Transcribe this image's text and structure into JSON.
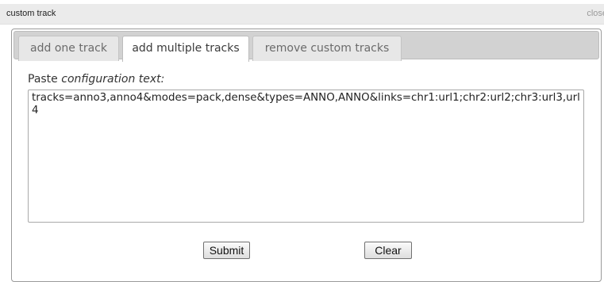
{
  "window": {
    "title": "custom track",
    "close_label": "close"
  },
  "tabs": [
    {
      "label": "add one track",
      "active": false
    },
    {
      "label": "add multiple tracks",
      "active": true
    },
    {
      "label": "remove custom tracks",
      "active": false
    }
  ],
  "form": {
    "prompt_prefix": "Paste ",
    "prompt_emphasis": "configuration text:",
    "config_text": "tracks=anno3,anno4&modes=pack,dense&types=ANNO,ANNO&links=chr1:url1;chr2:url2;chr3:url3,url4",
    "submit_label": "Submit",
    "clear_label": "Clear"
  }
}
